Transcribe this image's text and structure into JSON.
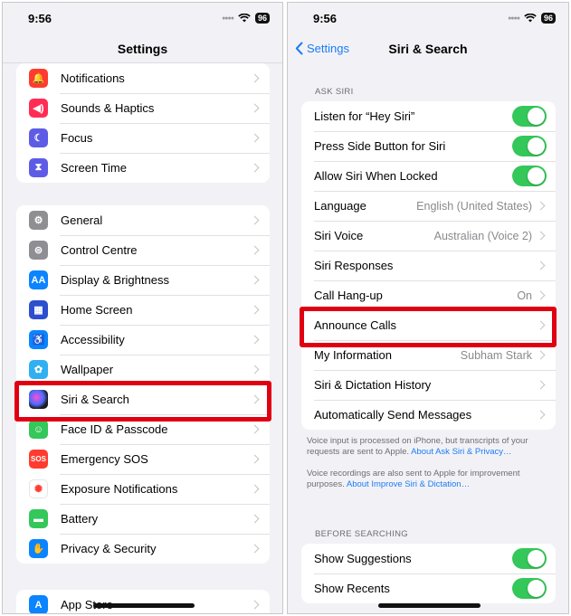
{
  "left": {
    "time": "9:56",
    "battery": "96",
    "title": "Settings",
    "group1": [
      {
        "label": "Notifications",
        "icon": "bell-icon",
        "color": "#ff3b30"
      },
      {
        "label": "Sounds & Haptics",
        "icon": "speaker-icon",
        "color": "#ff2d55"
      },
      {
        "label": "Focus",
        "icon": "moon-icon",
        "color": "#5e5ce6"
      },
      {
        "label": "Screen Time",
        "icon": "hourglass-icon",
        "color": "#5e5ce6"
      }
    ],
    "group2": [
      {
        "label": "General",
        "icon": "gear-icon",
        "color": "#8e8e93"
      },
      {
        "label": "Control Centre",
        "icon": "toggles-icon",
        "color": "#8e8e93"
      },
      {
        "label": "Display & Brightness",
        "icon": "text-size-icon",
        "color": "#0a84ff"
      },
      {
        "label": "Home Screen",
        "icon": "grid-icon",
        "color": "#2c4ecf"
      },
      {
        "label": "Accessibility",
        "icon": "accessibility-icon",
        "color": "#0a84ff"
      },
      {
        "label": "Wallpaper",
        "icon": "flower-icon",
        "color": "#30b0f0"
      },
      {
        "label": "Siri & Search",
        "icon": "siri-icon",
        "color": "#1c1c1e"
      },
      {
        "label": "Face ID & Passcode",
        "icon": "face-id-icon",
        "color": "#34c759"
      },
      {
        "label": "Emergency SOS",
        "icon": "sos-icon",
        "color": "#ff3b30"
      },
      {
        "label": "Exposure Notifications",
        "icon": "exposure-icon",
        "color": "#ffffff"
      },
      {
        "label": "Battery",
        "icon": "battery-icon",
        "color": "#34c759"
      },
      {
        "label": "Privacy & Security",
        "icon": "hand-icon",
        "color": "#0a84ff"
      }
    ],
    "group3": [
      {
        "label": "App Store",
        "icon": "app-store-icon",
        "color": "#0a84ff"
      }
    ]
  },
  "right": {
    "time": "9:56",
    "battery": "96",
    "back_label": "Settings",
    "title": "Siri & Search",
    "ask_siri_header": "ASK SIRI",
    "ask_siri_rows": [
      {
        "label": "Listen for “Hey Siri”",
        "type": "toggle",
        "on": true
      },
      {
        "label": "Press Side Button for Siri",
        "type": "toggle",
        "on": true
      },
      {
        "label": "Allow Siri When Locked",
        "type": "toggle",
        "on": true
      },
      {
        "label": "Language",
        "type": "link",
        "value": "English (United States)"
      },
      {
        "label": "Siri Voice",
        "type": "link",
        "value": "Australian (Voice 2)"
      },
      {
        "label": "Siri Responses",
        "type": "link",
        "value": ""
      },
      {
        "label": "Call Hang-up",
        "type": "link",
        "value": "On"
      },
      {
        "label": "Announce Calls",
        "type": "link",
        "value": ""
      },
      {
        "label": "My Information",
        "type": "link",
        "value": "Subham Stark"
      },
      {
        "label": "Siri & Dictation History",
        "type": "link",
        "value": ""
      },
      {
        "label": "Automatically Send Messages",
        "type": "link",
        "value": ""
      }
    ],
    "footnote1_text": "Voice input is processed on iPhone, but transcripts of your requests are sent to Apple.",
    "footnote1_link": "About Ask Siri & Privacy…",
    "footnote2_text": "Voice recordings are also sent to Apple for improvement purposes.",
    "footnote2_link": "About Improve Siri & Dictation…",
    "before_searching_header": "BEFORE SEARCHING",
    "before_searching_rows": [
      {
        "label": "Show Suggestions",
        "type": "toggle",
        "on": true
      },
      {
        "label": "Show Recents",
        "type": "toggle",
        "on": true
      }
    ]
  },
  "colors": {
    "toggle_on": "#34c759",
    "link": "#1c7cf4",
    "highlight": "#e00012"
  }
}
